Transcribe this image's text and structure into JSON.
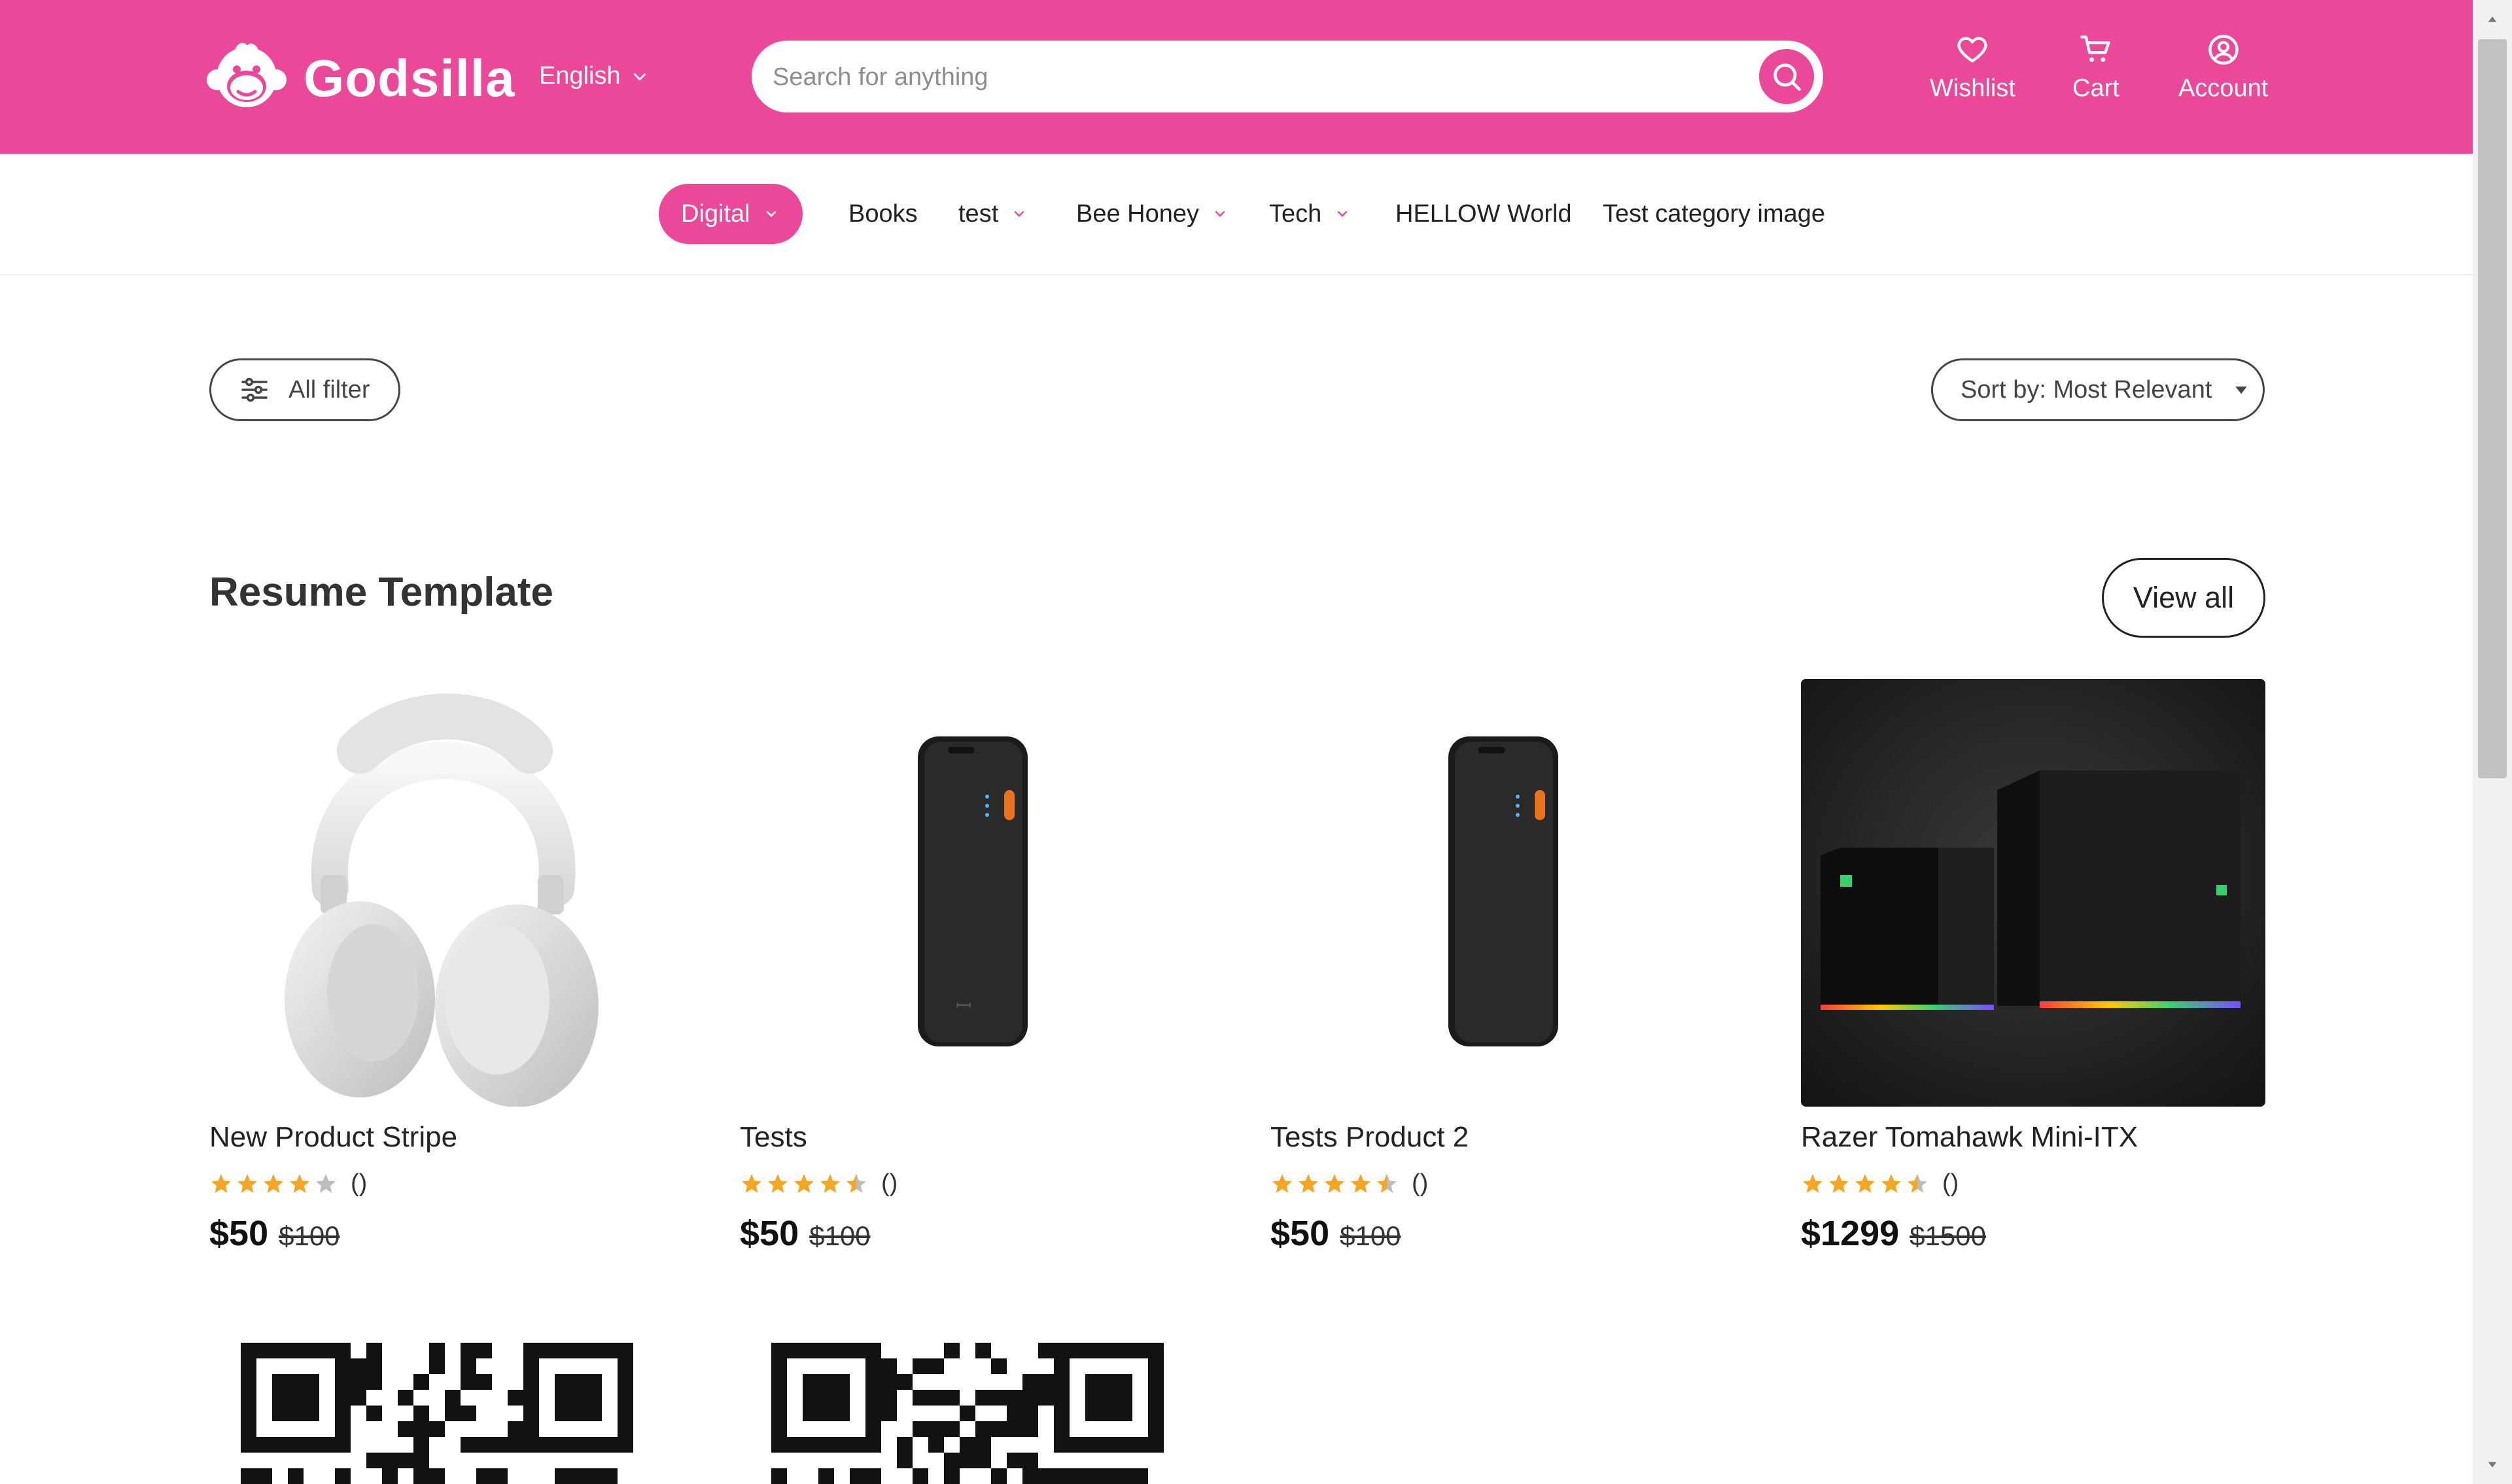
{
  "header": {
    "brand": "Godsilla",
    "language": "English",
    "search_placeholder": "Search for anything",
    "nav": {
      "wishlist": "Wishlist",
      "cart": "Cart",
      "account": "Account"
    }
  },
  "categories": [
    {
      "label": "Digital",
      "dropdown": true,
      "active": true
    },
    {
      "label": "Books",
      "dropdown": false
    },
    {
      "label": "test",
      "dropdown": true
    },
    {
      "label": "Bee Honey",
      "dropdown": true
    },
    {
      "label": "Tech",
      "dropdown": true
    },
    {
      "label": "HELLOW World",
      "dropdown": false
    },
    {
      "label": "Test category image",
      "dropdown": false
    }
  ],
  "toolbar": {
    "filter_label": "All filter",
    "sort_label": "Sort by: Most Relevant"
  },
  "section": {
    "title": "Resume Template",
    "view_all": "View all"
  },
  "products": [
    {
      "title": "New Product Stripe",
      "rating": 4,
      "rating_count": "()",
      "price": "$50",
      "old_price": "$100",
      "image": "headphones"
    },
    {
      "title": "Tests",
      "rating": 4.5,
      "rating_count": "()",
      "price": "$50",
      "old_price": "$100",
      "image": "power-bank"
    },
    {
      "title": "Tests Product 2",
      "rating": 4.5,
      "rating_count": "()",
      "price": "$50",
      "old_price": "$100",
      "image": "power-bank"
    },
    {
      "title": "Razer Tomahawk Mini-ITX",
      "rating": 4.5,
      "rating_count": "()",
      "price": "$1299",
      "old_price": "$1500",
      "image": "pc-cases"
    }
  ],
  "colors": {
    "brand_pink": "#ec4899",
    "star_fill": "#f5a623",
    "star_empty": "#bdbdbd"
  },
  "icons": [
    "monkey-logo-icon",
    "chevron-down-icon",
    "search-icon",
    "heart-icon",
    "cart-icon",
    "user-circle-icon",
    "sliders-icon",
    "caret-down-icon",
    "star-icon",
    "qr-code-icon"
  ]
}
